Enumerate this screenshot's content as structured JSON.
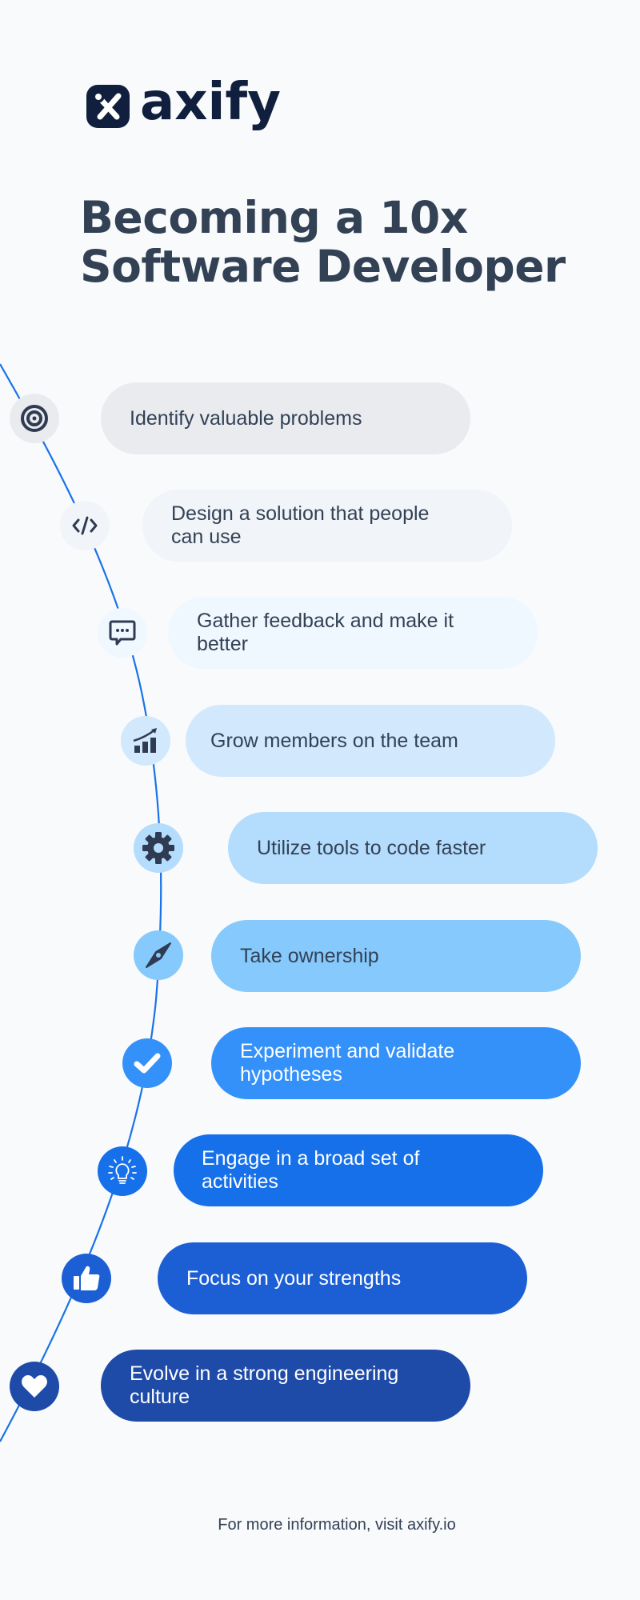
{
  "brand": {
    "name": "axify",
    "logo_icon": "axify-x-logo-icon",
    "color": "#101f3d"
  },
  "title": {
    "line1": "Becoming a 10x",
    "line2": "Software Developer"
  },
  "timeline": {
    "line_color": "#1a73e8",
    "steps": [
      {
        "label": "Identify valuable problems",
        "icon": "target-icon",
        "bg": "#e9ebef",
        "text_color": "#334155"
      },
      {
        "label": "Design a solution that people can use",
        "icon": "code-icon",
        "bg": "#f1f4f8",
        "text_color": "#334155"
      },
      {
        "label": "Gather feedback and make it better",
        "icon": "chat-bubble-icon",
        "bg": "#eff7ff",
        "text_color": "#334155"
      },
      {
        "label": "Grow members on the team",
        "icon": "growth-chart-icon",
        "bg": "#d1e8fd",
        "text_color": "#334155"
      },
      {
        "label": "Utilize tools to code faster",
        "icon": "gear-icon",
        "bg": "#b3dcfd",
        "text_color": "#334155"
      },
      {
        "label": "Take ownership",
        "icon": "compass-icon",
        "bg": "#86c9fc",
        "text_color": "#334155"
      },
      {
        "label": "Experiment and validate hypotheses",
        "icon": "checkmark-icon",
        "bg": "#3491fa",
        "text_color": "#ffffff"
      },
      {
        "label": "Engage in a broad set of activities",
        "icon": "lightbulb-icon",
        "bg": "#1670ea",
        "text_color": "#ffffff"
      },
      {
        "label": "Focus on your strengths",
        "icon": "thumbs-up-icon",
        "bg": "#1c5fd4",
        "text_color": "#ffffff"
      },
      {
        "label": "Evolve in a strong engineering culture",
        "icon": "heart-icon",
        "bg": "#1e4aa8",
        "text_color": "#ffffff"
      }
    ]
  },
  "footer": {
    "text": "For more information, visit axify.io"
  }
}
